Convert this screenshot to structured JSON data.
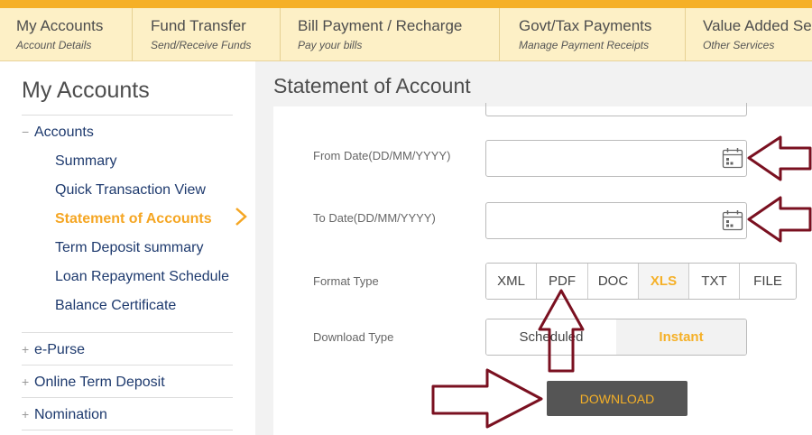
{
  "nav": [
    {
      "title": "My Accounts",
      "sub": "Account Details"
    },
    {
      "title": "Fund Transfer",
      "sub": "Send/Receive Funds"
    },
    {
      "title": "Bill Payment / Recharge",
      "sub": "Pay your bills"
    },
    {
      "title": "Govt/Tax Payments",
      "sub": "Manage Payment Receipts"
    },
    {
      "title": "Value Added Ser",
      "sub": "Other Services"
    }
  ],
  "sidebar": {
    "title": "My Accounts",
    "group_accounts": {
      "sign": "−",
      "label": "Accounts"
    },
    "links": [
      "Summary",
      "Quick Transaction View",
      "Statement of Accounts",
      "Term Deposit summary",
      "Loan Repayment Schedule",
      "Balance Certificate"
    ],
    "active_link": "Statement of Accounts",
    "groups": [
      {
        "sign": "+",
        "label": "e-Purse"
      },
      {
        "sign": "+",
        "label": "Online Term Deposit"
      },
      {
        "sign": "+",
        "label": "Nomination"
      }
    ]
  },
  "main": {
    "title": "Statement of Account",
    "from_date_label": "From Date(DD/MM/YYYY)",
    "to_date_label": "To Date(DD/MM/YYYY)",
    "format_label": "Format Type",
    "formats": [
      "XML",
      "PDF",
      "DOC",
      "XLS",
      "TXT",
      "FILE"
    ],
    "selected_format": "XLS",
    "download_type_label": "Download Type",
    "download_types": [
      "Scheduled",
      "Instant"
    ],
    "selected_download_type": "Instant",
    "download_button": "DOWNLOAD"
  },
  "colors": {
    "accent": "#f5b027",
    "nav_bg": "#fdf0c6",
    "annotation_arrow": "#7a1020"
  }
}
